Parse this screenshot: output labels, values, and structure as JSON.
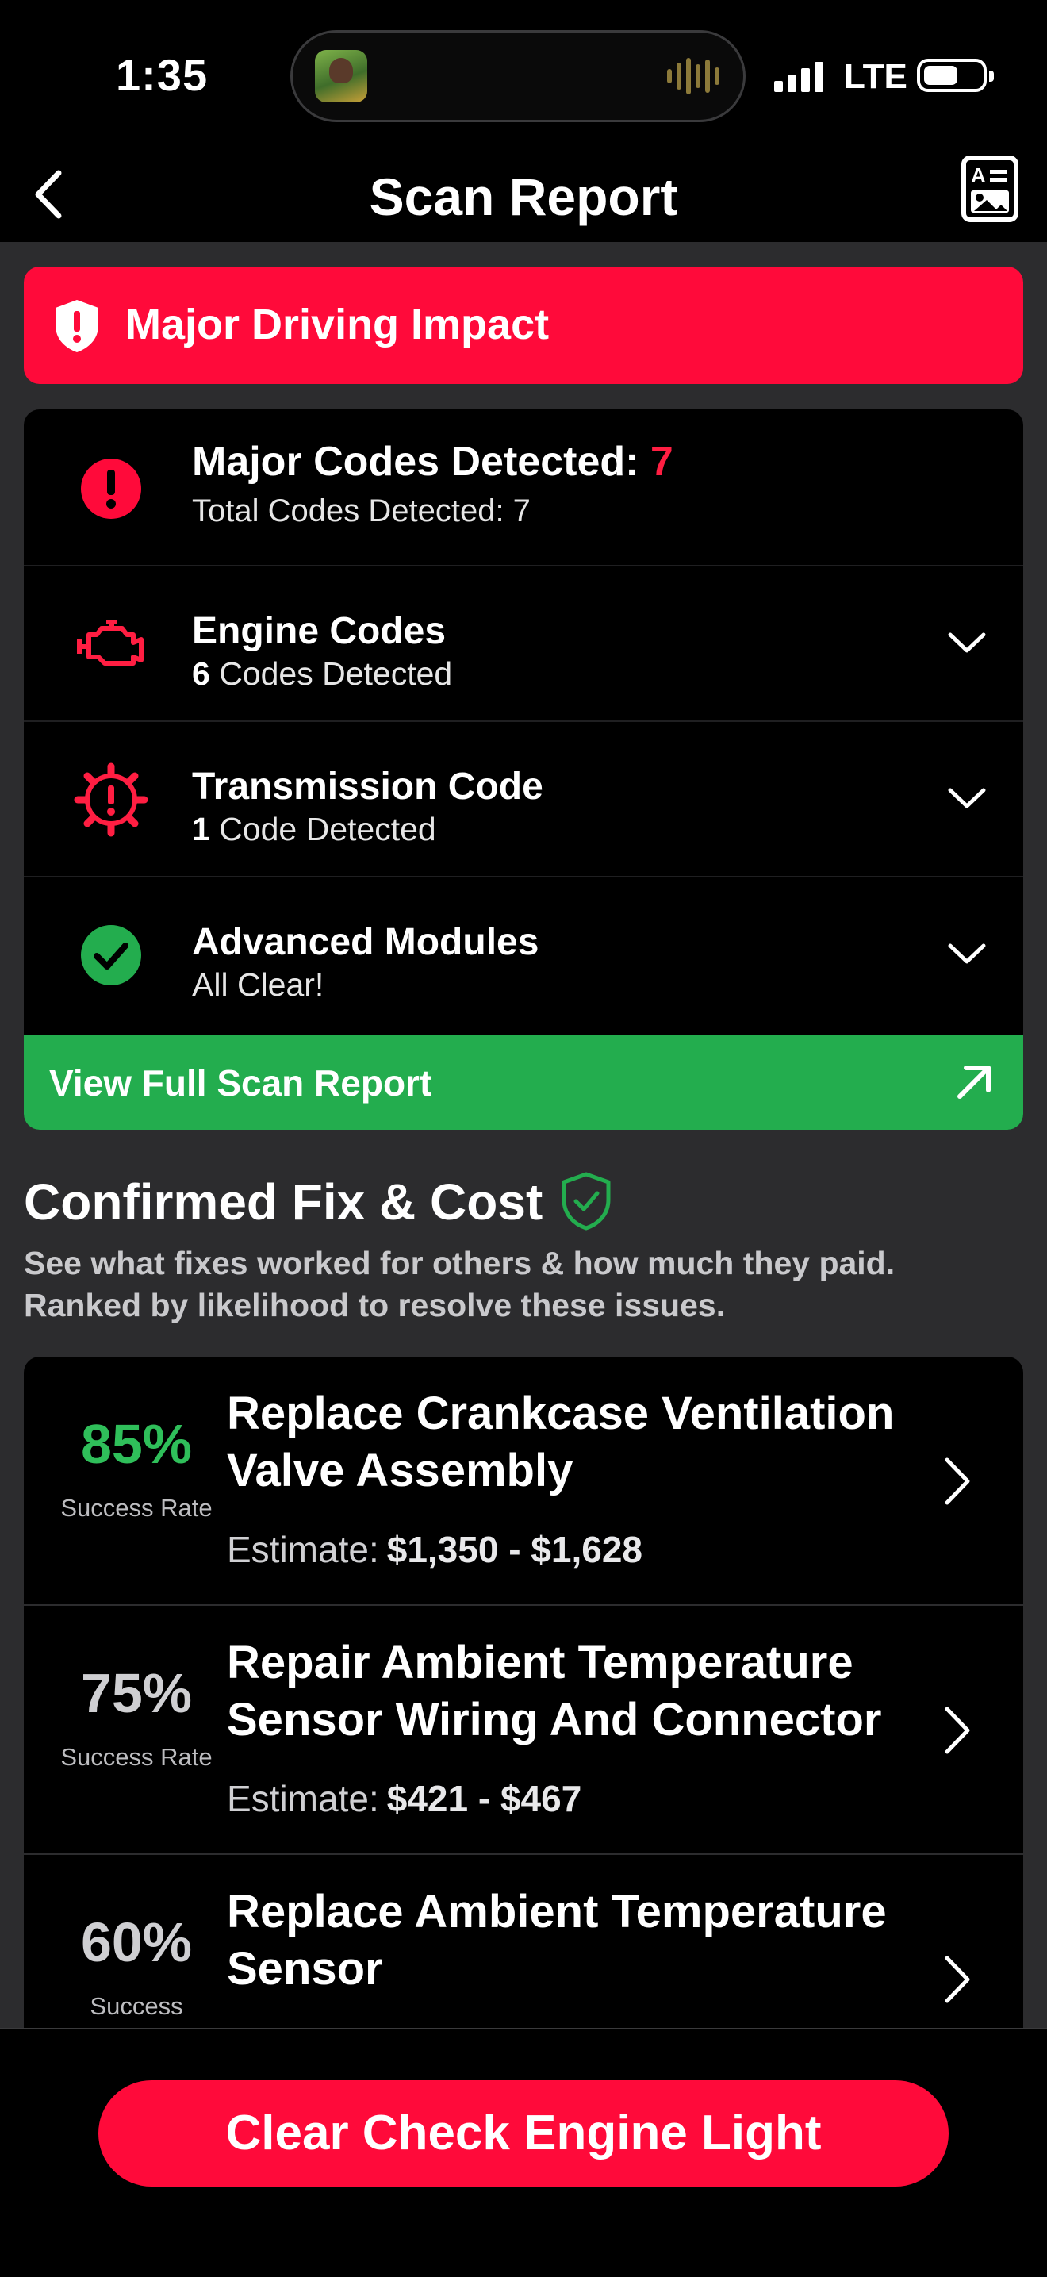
{
  "status_bar": {
    "time": "1:35",
    "network": "LTE"
  },
  "nav": {
    "title": "Scan Report"
  },
  "impact_banner": {
    "label": "Major Driving Impact",
    "color": "#ff0a3a"
  },
  "summary": {
    "major_label": "Major Codes Detected:",
    "major_count": "7",
    "total_label": "Total Codes Detected: 7"
  },
  "code_groups": [
    {
      "title": "Engine Codes",
      "count": "6",
      "count_label": "Codes Detected",
      "icon": "engine-icon"
    },
    {
      "title": "Transmission Code",
      "count": "1",
      "count_label": "Code Detected",
      "icon": "gear-warning-icon"
    },
    {
      "title": "Advanced Modules",
      "status": "All Clear!",
      "icon": "check-circle-icon"
    }
  ],
  "view_report": {
    "label": "View Full Scan Report",
    "color": "#23ad4e"
  },
  "section": {
    "title": "Confirmed Fix & Cost",
    "description": "See what fixes worked for others & how much they paid. Ranked by likelihood to resolve these issues."
  },
  "fixes": [
    {
      "rate": "85%",
      "rate_label": "Success Rate",
      "name": "Replace Crankcase Ventilation Valve Assembly",
      "estimate_label": "Estimate:",
      "estimate": "$1,350 - $1,628"
    },
    {
      "rate": "75%",
      "rate_label": "Success Rate",
      "name": "Repair Ambient Temperature Sensor Wiring And Connector",
      "estimate_label": "Estimate:",
      "estimate": "$421 - $467"
    },
    {
      "rate": "60%",
      "rate_label": "Success",
      "name": "Replace Ambient Temperature Sensor"
    }
  ],
  "bottom": {
    "clear_label": "Clear Check Engine Light",
    "color": "#ff0a3a"
  }
}
